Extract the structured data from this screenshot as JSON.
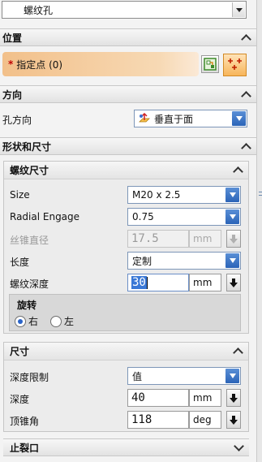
{
  "top": {
    "selected": "螺纹孔"
  },
  "sections": {
    "position": "位置",
    "direction": "方向",
    "shape_size": "形状和尺寸",
    "relief": "止裂口"
  },
  "position": {
    "specify_point_label": "指定点 (0)",
    "required_mark": "*"
  },
  "direction": {
    "hole_dir_label": "孔方向",
    "hole_dir_value": "垂直于面"
  },
  "thread": {
    "title": "螺纹尺寸",
    "size_label": "Size",
    "size_value": "M20 x 2.5",
    "radial_label": "Radial Engage",
    "radial_value": "0.75",
    "taper_dia_label": "丝锥直径",
    "taper_dia_value": "17.5",
    "taper_dia_unit": "mm",
    "length_label": "长度",
    "length_value": "定制",
    "depth_label": "螺纹深度",
    "depth_value": "30",
    "depth_unit": "mm",
    "rotation": {
      "title": "旋转",
      "right": "右",
      "left": "左",
      "selected": "右"
    }
  },
  "dimensions": {
    "title": "尺寸",
    "depth_limit_label": "深度限制",
    "depth_limit_value": "值",
    "depth_label": "深度",
    "depth_value": "40",
    "depth_unit": "mm",
    "tip_angle_label": "顶锥角",
    "tip_angle_value": "118",
    "tip_angle_unit": "deg"
  },
  "colors": {
    "accent_blue": "#2b64b8",
    "point_bar": "#f2c08a",
    "required_red": "#c00000"
  }
}
